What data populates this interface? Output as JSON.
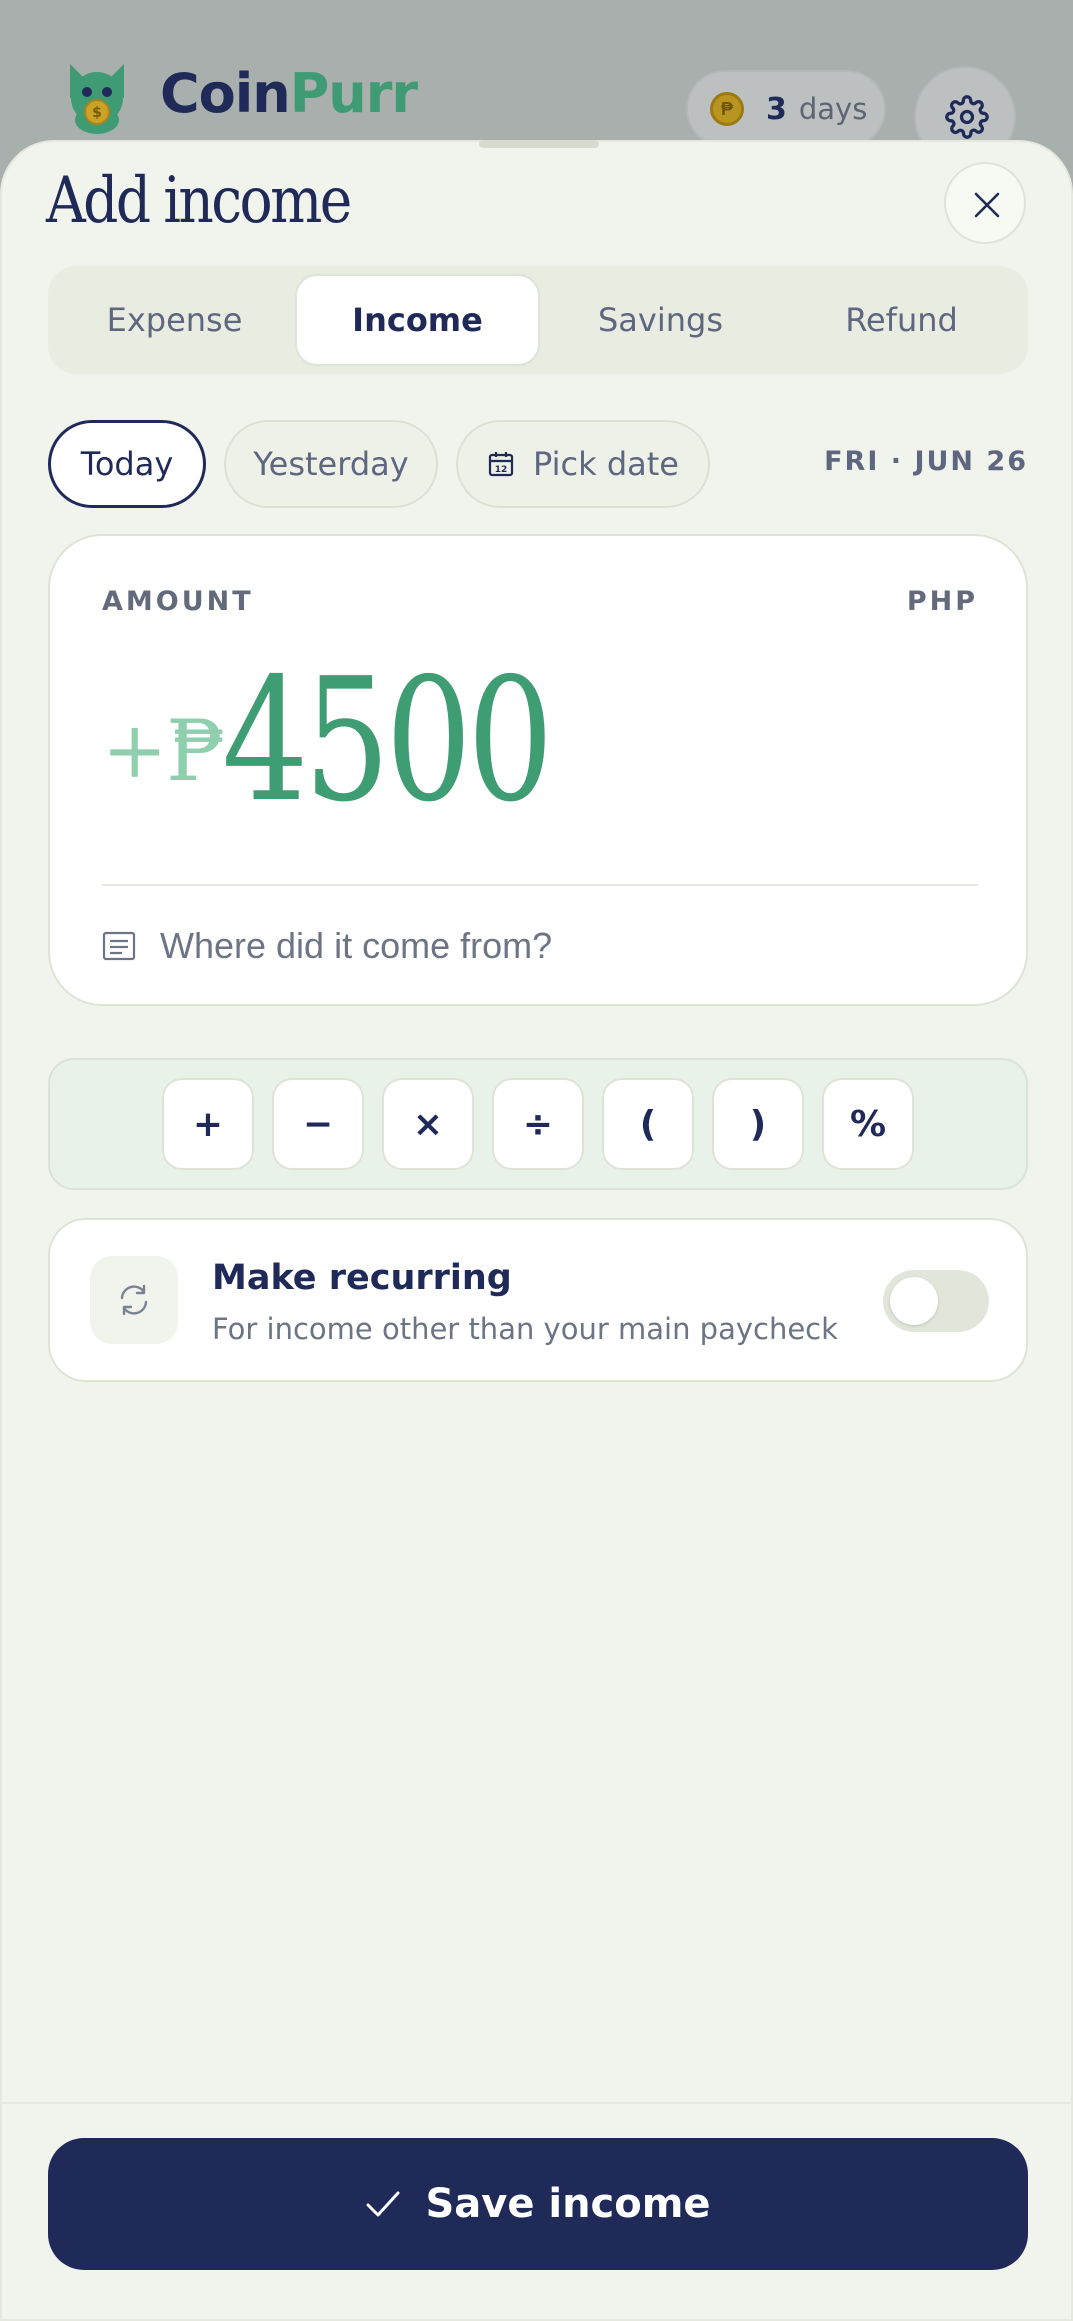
{
  "app": {
    "brand_part1": "Coin",
    "brand_part2": "Purr",
    "streak_count": "3",
    "streak_unit": "days",
    "colors": {
      "navy": "#1f2a58",
      "green": "#3e9d73",
      "light_green": "#8fcfae"
    },
    "icons": {
      "logo": "cat-coin-logo",
      "streak": "peso-coin-icon",
      "settings": "gear-icon"
    }
  },
  "sheet": {
    "title": "Add income",
    "close_icon": "close-icon",
    "tabs": [
      {
        "label": "Expense",
        "active": false
      },
      {
        "label": "Income",
        "active": true
      },
      {
        "label": "Savings",
        "active": false
      },
      {
        "label": "Refund",
        "active": false
      }
    ],
    "date": {
      "today": "Today",
      "yesterday": "Yesterday",
      "pick": "Pick date",
      "selected": "Today",
      "display": "FRI · JUN 26"
    },
    "amount": {
      "label": "AMOUNT",
      "currency": "PHP",
      "sign": "+",
      "symbol": "₱",
      "value": "4500",
      "note_placeholder": "Where did it come from?",
      "note_value": ""
    },
    "operators": [
      "+",
      "−",
      "×",
      "÷",
      "(",
      ")",
      "%"
    ],
    "recurring": {
      "title": "Make recurring",
      "subtitle": "For income other than your main paycheck",
      "enabled": false
    },
    "save_label": "Save income"
  }
}
